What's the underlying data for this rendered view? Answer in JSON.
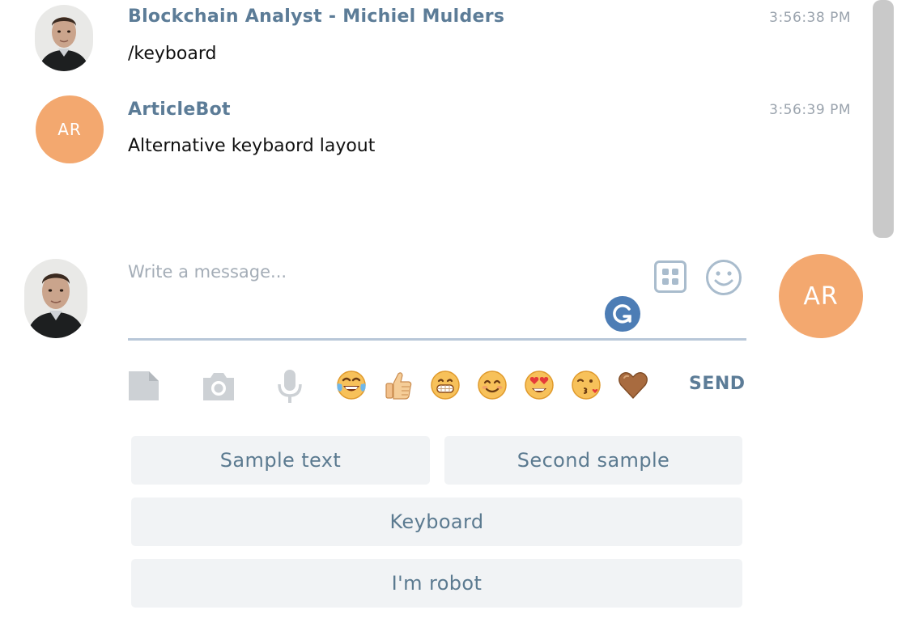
{
  "theme": {
    "author_color": "#5c7c97",
    "avatar_orange": "#f3a86f",
    "send_color": "#5c7c97"
  },
  "messages": [
    {
      "author": "Blockchain Analyst - Michiel Mulders",
      "text": "/keyboard",
      "time": "3:56:38 PM",
      "avatar_type": "photo"
    },
    {
      "author": "ArticleBot",
      "text": "Alternative keybaord layout",
      "time": "3:56:39 PM",
      "avatar_type": "initials",
      "avatar_initials": "AR"
    }
  ],
  "composer": {
    "placeholder": "Write a message...",
    "value": "",
    "commands_icon": "bot-commands-icon",
    "emoji_icon": "smile-icon",
    "grammarly_icon": "grammarly-icon",
    "peer_initials": "AR"
  },
  "toolbar": {
    "attach_icon": "file-icon",
    "camera_icon": "camera-icon",
    "mic_icon": "microphone-icon",
    "quick_emojis": [
      "😂",
      "👍",
      "😁",
      "😊",
      "😍",
      "😘",
      "🤎"
    ],
    "send_label": "SEND"
  },
  "reply_keyboard": {
    "rows": [
      [
        "Sample text",
        "Second sample"
      ],
      [
        "Keyboard"
      ],
      [
        "I'm robot"
      ]
    ]
  }
}
